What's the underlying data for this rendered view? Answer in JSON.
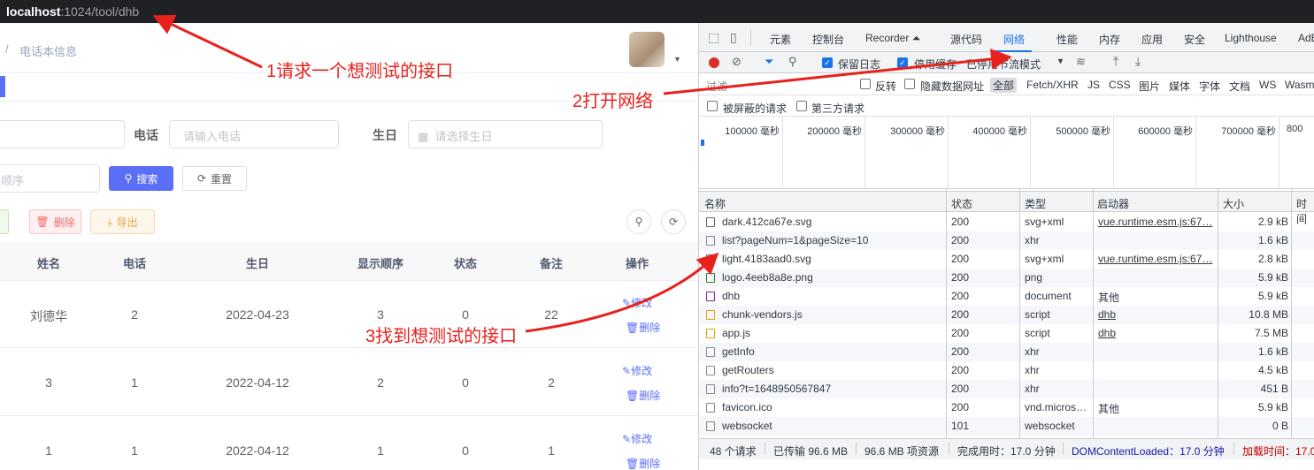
{
  "address_bar": {
    "host": "localhost",
    "path": ":1024/tool/dhb"
  },
  "app": {
    "breadcrumb_sep": "/",
    "breadcrumb": "电话本信息",
    "search": {
      "phone_label": "电话",
      "phone_placeholder": "请输入电话",
      "birthday_label": "生日",
      "birthday_placeholder": "请选择生日",
      "order_placeholder_partial": "顺序",
      "search_button": "搜索",
      "reset_button": "重置"
    },
    "actions": {
      "delete": "删除",
      "export": "导出"
    },
    "table": {
      "headers": [
        "姓名",
        "电话",
        "生日",
        "显示顺序",
        "状态",
        "备注",
        "操作"
      ],
      "rows": [
        [
          "刘德华",
          "2",
          "2022-04-23",
          "3",
          "0",
          "22"
        ],
        [
          "3",
          "1",
          "2022-04-12",
          "2",
          "0",
          "2"
        ],
        [
          "1",
          "1",
          "2022-04-12",
          "1",
          "0",
          "1"
        ]
      ],
      "edit_label": "修改",
      "delete_label": "删除"
    }
  },
  "devtools": {
    "tabs": [
      "元素",
      "控制台",
      "Recorder ⏶",
      "源代码",
      "网络",
      "性能",
      "内存",
      "应用",
      "安全",
      "Lighthouse",
      "AdB"
    ],
    "active_tab": "网络",
    "toolbar": {
      "preserve_log": "保留日志",
      "disable_cache": "停用缓存",
      "throttle": "已停用节流模式"
    },
    "filter": {
      "placeholder": "过滤",
      "invert": "反转",
      "hide_data_urls": "隐藏数据网址",
      "types": [
        "全部",
        "Fetch/XHR",
        "JS",
        "CSS",
        "图片",
        "媒体",
        "字体",
        "文档",
        "WS",
        "Wasm"
      ],
      "blocked": "被屏蔽的请求",
      "third_party": "第三方请求"
    },
    "timeline_ticks": [
      "100000 毫秒",
      "200000 毫秒",
      "300000 毫秒",
      "400000 毫秒",
      "500000 毫秒",
      "600000 毫秒",
      "700000 毫秒",
      "800"
    ],
    "columns": [
      "名称",
      "状态",
      "类型",
      "启动器",
      "大小",
      "时间"
    ],
    "requests": [
      {
        "name": "dark.412ca67e.svg",
        "status": "200",
        "type": "svg+xml",
        "initiator": "vue.runtime.esm.js:67…",
        "size": "2.9 kB",
        "icon": "svg"
      },
      {
        "name": "list?pageNum=1&pageSize=10",
        "status": "200",
        "type": "xhr",
        "initiator": "",
        "size": "1.6 kB",
        "icon": "doc"
      },
      {
        "name": "light.4183aad0.svg",
        "status": "200",
        "type": "svg+xml",
        "initiator": "vue.runtime.esm.js:67…",
        "size": "2.8 kB",
        "icon": "svg"
      },
      {
        "name": "logo.4eeb8a8e.png",
        "status": "200",
        "type": "png",
        "initiator": "",
        "size": "5.9 kB",
        "icon": "img"
      },
      {
        "name": "dhb",
        "status": "200",
        "type": "document",
        "initiator": "其他",
        "size": "5.9 kB",
        "icon": "html"
      },
      {
        "name": "chunk-vendors.js",
        "status": "200",
        "type": "script",
        "initiator": "dhb",
        "size": "10.8 MB",
        "icon": "js"
      },
      {
        "name": "app.js",
        "status": "200",
        "type": "script",
        "initiator": "dhb",
        "size": "7.5 MB",
        "icon": "js"
      },
      {
        "name": "getInfo",
        "status": "200",
        "type": "xhr",
        "initiator": "",
        "size": "1.6 kB",
        "icon": "doc"
      },
      {
        "name": "getRouters",
        "status": "200",
        "type": "xhr",
        "initiator": "",
        "size": "4.5 kB",
        "icon": "doc"
      },
      {
        "name": "info?t=1648950567847",
        "status": "200",
        "type": "xhr",
        "initiator": "",
        "size": "451 B",
        "icon": "doc"
      },
      {
        "name": "favicon.ico",
        "status": "200",
        "type": "vnd.micros…",
        "initiator": "其他",
        "size": "5.9 kB",
        "icon": "doc"
      },
      {
        "name": "websocket",
        "status": "101",
        "type": "websocket",
        "initiator": "",
        "size": "0 B",
        "icon": "doc"
      }
    ],
    "status_bar": {
      "requests": "48 个请求",
      "transferred": "已传输 96.6 MB",
      "resources": "96.6 MB 项资源",
      "finish": "完成用时：17.0 分钟",
      "dom": "DOMContentLoaded：17.0 分钟",
      "load": "加载时间：17.0"
    }
  },
  "annotations": {
    "step1": "1请求一个想测试的接口",
    "step2": "2打开网络",
    "step3": "3找到想测试的接口",
    "color": "#e8211d"
  }
}
